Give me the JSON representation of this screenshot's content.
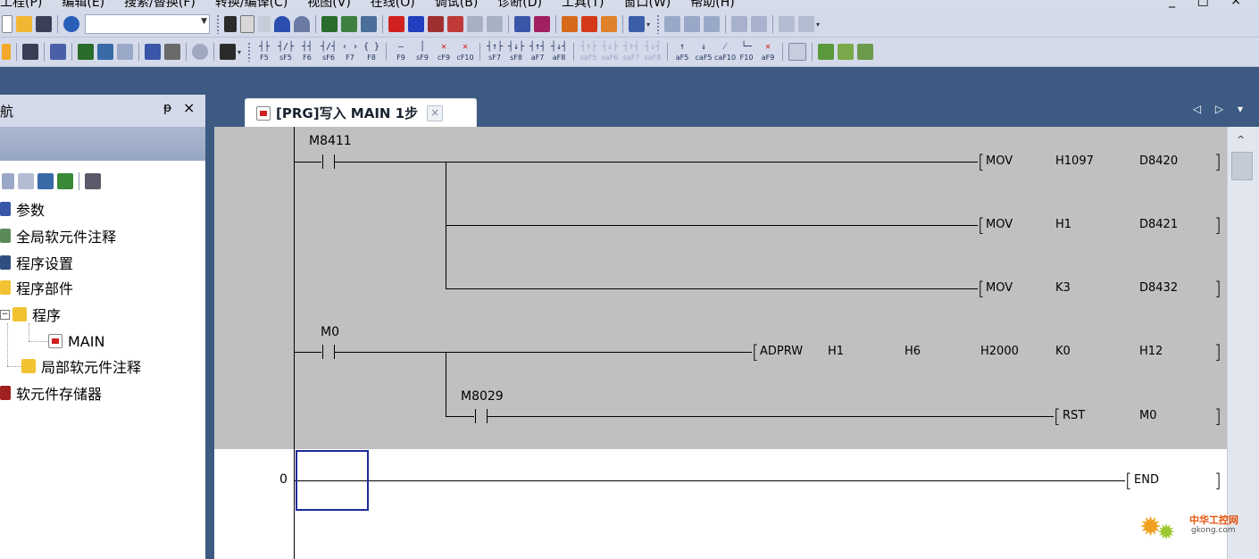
{
  "menu": {
    "items": [
      "工程(P)",
      "编辑(E)",
      "搜索/替换(F)",
      "转换/编译(C)",
      "视图(V)",
      "在线(O)",
      "调试(B)",
      "诊断(D)",
      "工具(T)",
      "窗口(W)",
      "帮助(H)"
    ],
    "window_controls": "_ □ ×"
  },
  "toolbar2_keys": [
    {
      "sym": "┤├",
      "label": "F5"
    },
    {
      "sym": "┤/├",
      "label": "sF5"
    },
    {
      "sym": "┤┤",
      "label": "F6"
    },
    {
      "sym": "┤/┤",
      "label": "sF6"
    },
    {
      "sym": "‹ ›",
      "label": "F7"
    },
    {
      "sym": "{ }",
      "label": "F8"
    },
    {
      "sym": "—",
      "label": "F9"
    },
    {
      "sym": "│",
      "label": "sF9"
    },
    {
      "sym": "✕",
      "label": "cF9"
    },
    {
      "sym": "✕",
      "label": "cF10"
    },
    {
      "sym": "┤↑├",
      "label": "sF7"
    },
    {
      "sym": "┤↓├",
      "label": "sF8"
    },
    {
      "sym": "┤↑┤",
      "label": "aF7"
    },
    {
      "sym": "┤↓┤",
      "label": "aF8"
    },
    {
      "sym": "┤↑├",
      "label": "saF5"
    },
    {
      "sym": "┤↓├",
      "label": "saF6"
    },
    {
      "sym": "┤↑┤",
      "label": "saF7"
    },
    {
      "sym": "┤↓┤",
      "label": "saF8"
    },
    {
      "sym": "↑",
      "label": "aF5"
    },
    {
      "sym": "↓",
      "label": "caF5"
    },
    {
      "sym": "⁄",
      "label": "caF10"
    },
    {
      "sym": "└─",
      "label": "F10"
    },
    {
      "sym": "✕",
      "label": "aF9"
    }
  ],
  "nav": {
    "title": "航",
    "pin": "ᵽ",
    "close": "×",
    "tree": {
      "parameters": "参数",
      "global_comment": "全局软元件注释",
      "program_settings": "程序设置",
      "program_parts": "程序部件",
      "program": "程序",
      "main": "MAIN",
      "local_comment": "局部软元件注释",
      "device_memory": "软元件存储器"
    }
  },
  "tab": {
    "label": "[PRG]写入 MAIN 1步",
    "close": "×",
    "scroll": "◁ ▷ ▾"
  },
  "ladder": {
    "rung1": {
      "contact": "M8411",
      "coils": [
        {
          "instr": "MOV",
          "op1": "H1097",
          "op2": "D8420"
        },
        {
          "instr": "MOV",
          "op1": "H1",
          "op2": "D8421"
        },
        {
          "instr": "MOV",
          "op1": "K3",
          "op2": "D8432"
        }
      ]
    },
    "rung2": {
      "contact": "M0",
      "coil": {
        "instr": "ADPRW",
        "ops": [
          "H1",
          "H6",
          "H2000",
          "K0",
          "H12"
        ]
      },
      "sub_contact": "M8029",
      "sub_coil": {
        "instr": "RST",
        "op1": "M0"
      }
    },
    "end_rung": {
      "step": "0",
      "instr": "END"
    },
    "bracket_open": "[",
    "bracket_close": "]"
  },
  "watermark": {
    "text": "中华工控网",
    "url": "gkong.com"
  },
  "colors": {
    "editor_gray": "#c0c0c0",
    "cursor": "#1c2a9c",
    "chrome": "#d4daea",
    "background": "#3c5a82"
  }
}
